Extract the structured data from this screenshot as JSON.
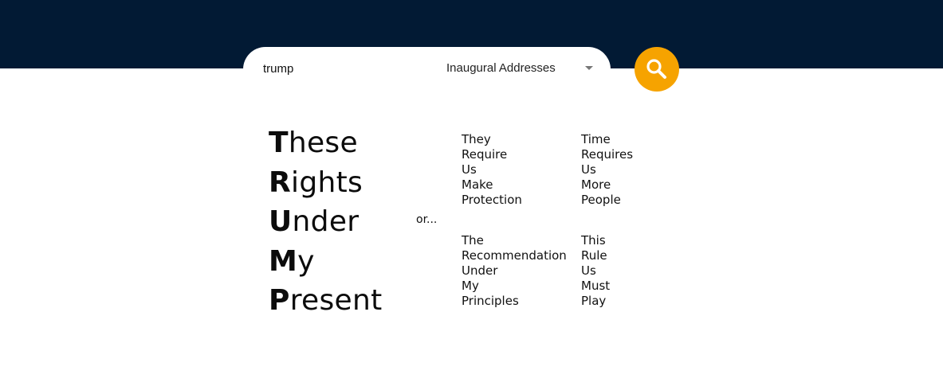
{
  "colors": {
    "header_band": "#021a34",
    "search_button": "#f6a300",
    "background": "#ffffff"
  },
  "search": {
    "query": "trump",
    "collection": "Inaugural Addresses",
    "button_icon": "search-icon"
  },
  "result": {
    "main_words": [
      "These",
      "Rights",
      "Under",
      "My",
      "Present"
    ],
    "or_label": "or...",
    "alternatives": [
      [
        "They",
        "Require",
        "Us",
        "Make",
        "Protection"
      ],
      [
        "Time",
        "Requires",
        "Us",
        "More",
        "People"
      ],
      [
        "The",
        "Recommendation",
        "Under",
        "My",
        "Principles"
      ],
      [
        "This",
        "Rule",
        "Us",
        "Must",
        "Play"
      ]
    ]
  }
}
